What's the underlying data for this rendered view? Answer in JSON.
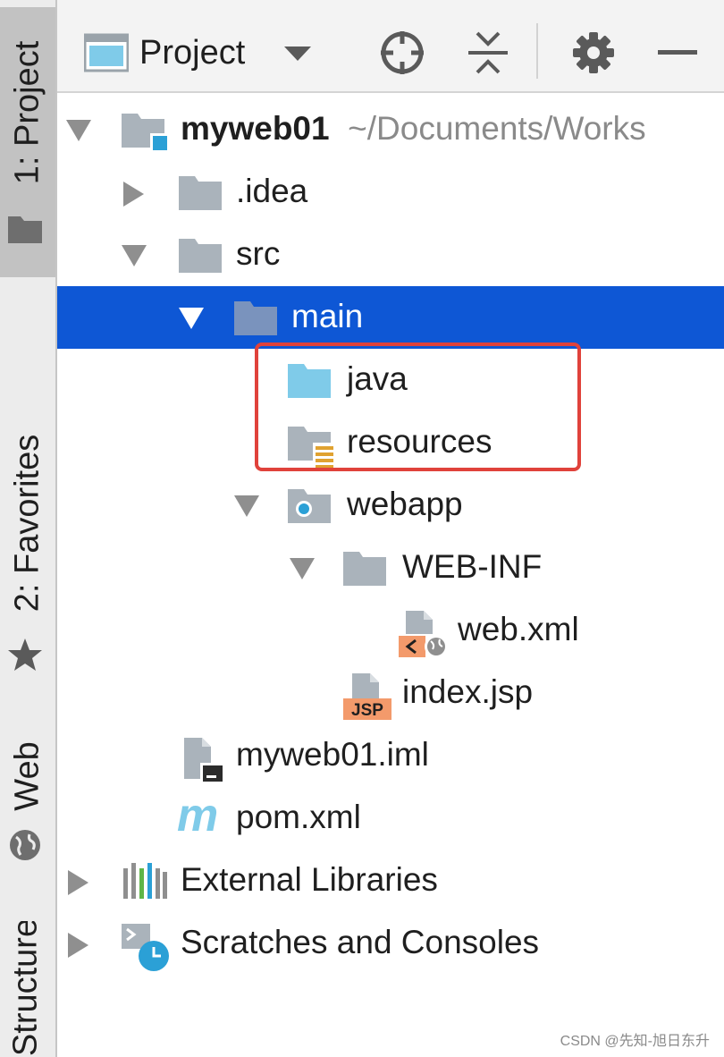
{
  "side_tabs": {
    "project": "1: Project",
    "favorites": "2: Favorites",
    "web": "Web",
    "structure": "Structure"
  },
  "toolbar": {
    "view_label": "Project"
  },
  "tree": {
    "root": {
      "name": "myweb01",
      "path": "~/Documents/Works"
    },
    "idea": ".idea",
    "src": "src",
    "main": "main",
    "java": "java",
    "resources": "resources",
    "webapp": "webapp",
    "webinf": "WEB-INF",
    "webxml": "web.xml",
    "indexjsp": "index.jsp",
    "iml": "myweb01.iml",
    "pom": "pom.xml",
    "external_libraries": "External Libraries",
    "scratches": "Scratches and Consoles"
  },
  "icon_text": {
    "jsp_badge": "JSP",
    "maven": "m"
  },
  "selected_item": "main",
  "highlighted_items": [
    "java",
    "resources"
  ],
  "colors": {
    "selection": "#0e57d5",
    "highlight_border": "#e0423b",
    "folder": "#aab3bb",
    "source_folder": "#7fcbe9",
    "resource_accent": "#e0a230"
  },
  "watermark": "CSDN @先知-旭日东升"
}
